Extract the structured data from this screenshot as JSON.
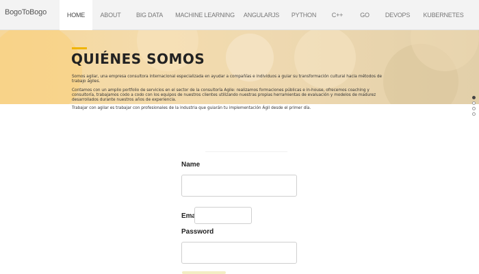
{
  "navbar": {
    "brand": "BogoToBogo",
    "items": [
      {
        "label": "HOME",
        "active": true
      },
      {
        "label": "ABOUT",
        "active": false
      },
      {
        "label": "BIG DATA",
        "active": false
      },
      {
        "label": "MACHINE LEARNING",
        "active": false
      },
      {
        "label": "ANGULARJS",
        "active": false
      },
      {
        "label": "PYTHON",
        "active": false
      },
      {
        "label": "C++",
        "active": false
      },
      {
        "label": "GO",
        "active": false
      },
      {
        "label": "DEVOPS",
        "active": false
      },
      {
        "label": "KUBERNETES",
        "active": false
      }
    ]
  },
  "hero": {
    "title": "QUIÉNES SOMOS",
    "paragraph1": "Somos agilar, una empresa consultora internacional especializada en ayudar a compañías e individuos a guiar su transformación cultural hacia métodos de trabajo ágiles.",
    "paragraph2": "Contamos con un amplio portfolio de servicios en el sector de la consultoría Agile: realizamos formaciones públicas e in-house, ofrecemos coaching y consultoría, trabajamos codo a codo con los equipos de nuestros clientes utilizando nuestras propias herramientas de evaluación y modelos de madurez desarrollados durante nuestros años de experiencia.",
    "paragraph3": "Trabajar con agilar es trabajar con profesionales de la industria que guiarán tu implementación Ágil desde el primer día."
  },
  "form": {
    "name_label": "Name",
    "name_value": "",
    "email_label": "Email",
    "email_value": "",
    "password_label": "Password",
    "password_value": ""
  },
  "colors": {
    "accent": "#f0b400",
    "nav_bg": "#f3f3f3",
    "hero_bg": "#f4dbab"
  }
}
